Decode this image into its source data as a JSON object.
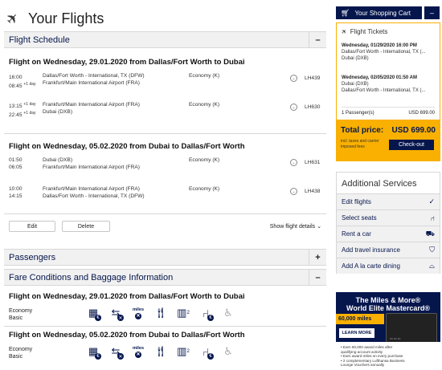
{
  "page": {
    "title": "Your Flights"
  },
  "schedule": {
    "section_title": "Flight Schedule",
    "toggle": "–",
    "flights": [
      {
        "heading": "Flight on Wednesday, 29.01.2020 from Dallas/Fort Worth to Dubai",
        "segments": [
          {
            "dep_time": "16:00",
            "dep_sup": "",
            "arr_time": "08:45",
            "arr_sup": "+1 day",
            "from": "Dallas/Fort Worth - International, TX (DFW)",
            "to": "Frankfurt/Main International Airport (FRA)",
            "cabin": "Economy (K)",
            "flight_no": "LH439"
          },
          {
            "dep_time": "13:15",
            "dep_sup": "+1 day",
            "arr_time": "22:45",
            "arr_sup": "+1 day",
            "from": "Frankfurt/Main International Airport (FRA)",
            "to": "Dubai (DXB)",
            "cabin": "Economy (K)",
            "flight_no": "LH630"
          }
        ]
      },
      {
        "heading": "Flight on Wednesday, 05.02.2020 from Dubai to Dallas/Fort Worth",
        "segments": [
          {
            "dep_time": "01:50",
            "dep_sup": "",
            "arr_time": "06:05",
            "arr_sup": "",
            "from": "Dubai (DXB)",
            "to": "Frankfurt/Main International Airport (FRA)",
            "cabin": "Economy (K)",
            "flight_no": "LH631"
          },
          {
            "dep_time": "10:00",
            "dep_sup": "",
            "arr_time": "14:15",
            "arr_sup": "",
            "from": "Frankfurt/Main International Airport (FRA)",
            "to": "Dallas/Fort Worth - International, TX (DFW)",
            "cabin": "Economy (K)",
            "flight_no": "LH438"
          }
        ]
      }
    ],
    "edit_label": "Edit",
    "delete_label": "Delete",
    "show_details_label": "Show flight details ⌄"
  },
  "passengers": {
    "section_title": "Passengers",
    "toggle": "+"
  },
  "fare": {
    "section_title": "Fare Conditions and Baggage Information",
    "toggle": "–",
    "flights": [
      {
        "heading": "Flight on Wednesday, 29.01.2020 from Dallas/Fort Worth to Dubai",
        "label1": "Economy",
        "label2": "Basic"
      },
      {
        "heading": "Flight on Wednesday, 05.02.2020 from Dubai to Dallas/Fort Worth",
        "label1": "Economy",
        "label2": "Basic"
      }
    ],
    "icons": [
      "calendar-fee-icon",
      "rebooking-excluded-icon",
      "miles-excluded-icon",
      "meal-icon",
      "carry-on-baggage-icon",
      "seat-reservation-fee-icon",
      "accessibility-icon"
    ],
    "miles_label": "miles"
  },
  "cart": {
    "button_label": "Your Shopping Cart",
    "close": "–",
    "tickets_label": "Flight Tickets",
    "items": [
      {
        "datetime": "Wednesday, 01/29/2020 16:00 PM",
        "line1": "Dallas/Fort Worth - International, TX (...",
        "line2": "Dubai (DXB)"
      },
      {
        "datetime": "Wednesday, 02/05/2020 01:50 AM",
        "line1": "Dubai (DXB)",
        "line2": "Dallas/Fort Worth - International, TX (..."
      }
    ],
    "passengers": "1 Passenger(s)",
    "passengers_price": "USD 699.00",
    "total_label": "Total price:",
    "total_value": "USD 699.00",
    "total_note": "incl. taxes and carrier imposed fees",
    "checkout_label": "Check-out"
  },
  "additional": {
    "title": "Additional Services",
    "items": [
      {
        "label": "Edit flights",
        "icon": "check-icon",
        "glyph": "✓"
      },
      {
        "label": "Select seats",
        "icon": "seat-icon",
        "glyph": "⑁"
      },
      {
        "label": "Rent a car",
        "icon": "car-icon",
        "glyph": "⛟"
      },
      {
        "label": "Add travel insurance",
        "icon": "shield-icon",
        "glyph": "⛉"
      },
      {
        "label": "Add A la carte dining",
        "icon": "dining-icon",
        "glyph": "⌓"
      }
    ]
  },
  "promo": {
    "line1": "The Miles & More®",
    "line2": "World Elite Mastercard®",
    "miles": "60,000 miles",
    "learn": "LEARN MORE",
    "bullets": [
      "• Earn 50,000 award miles after",
      "  qualifying account activity",
      "• Earn award miles on every purchase",
      "• 2 complementary Lufthansa Business",
      "  Lounge Vouchers annually"
    ]
  },
  "colors": {
    "brand_navy": "#05164d",
    "accent_yellow": "#f9b000"
  }
}
